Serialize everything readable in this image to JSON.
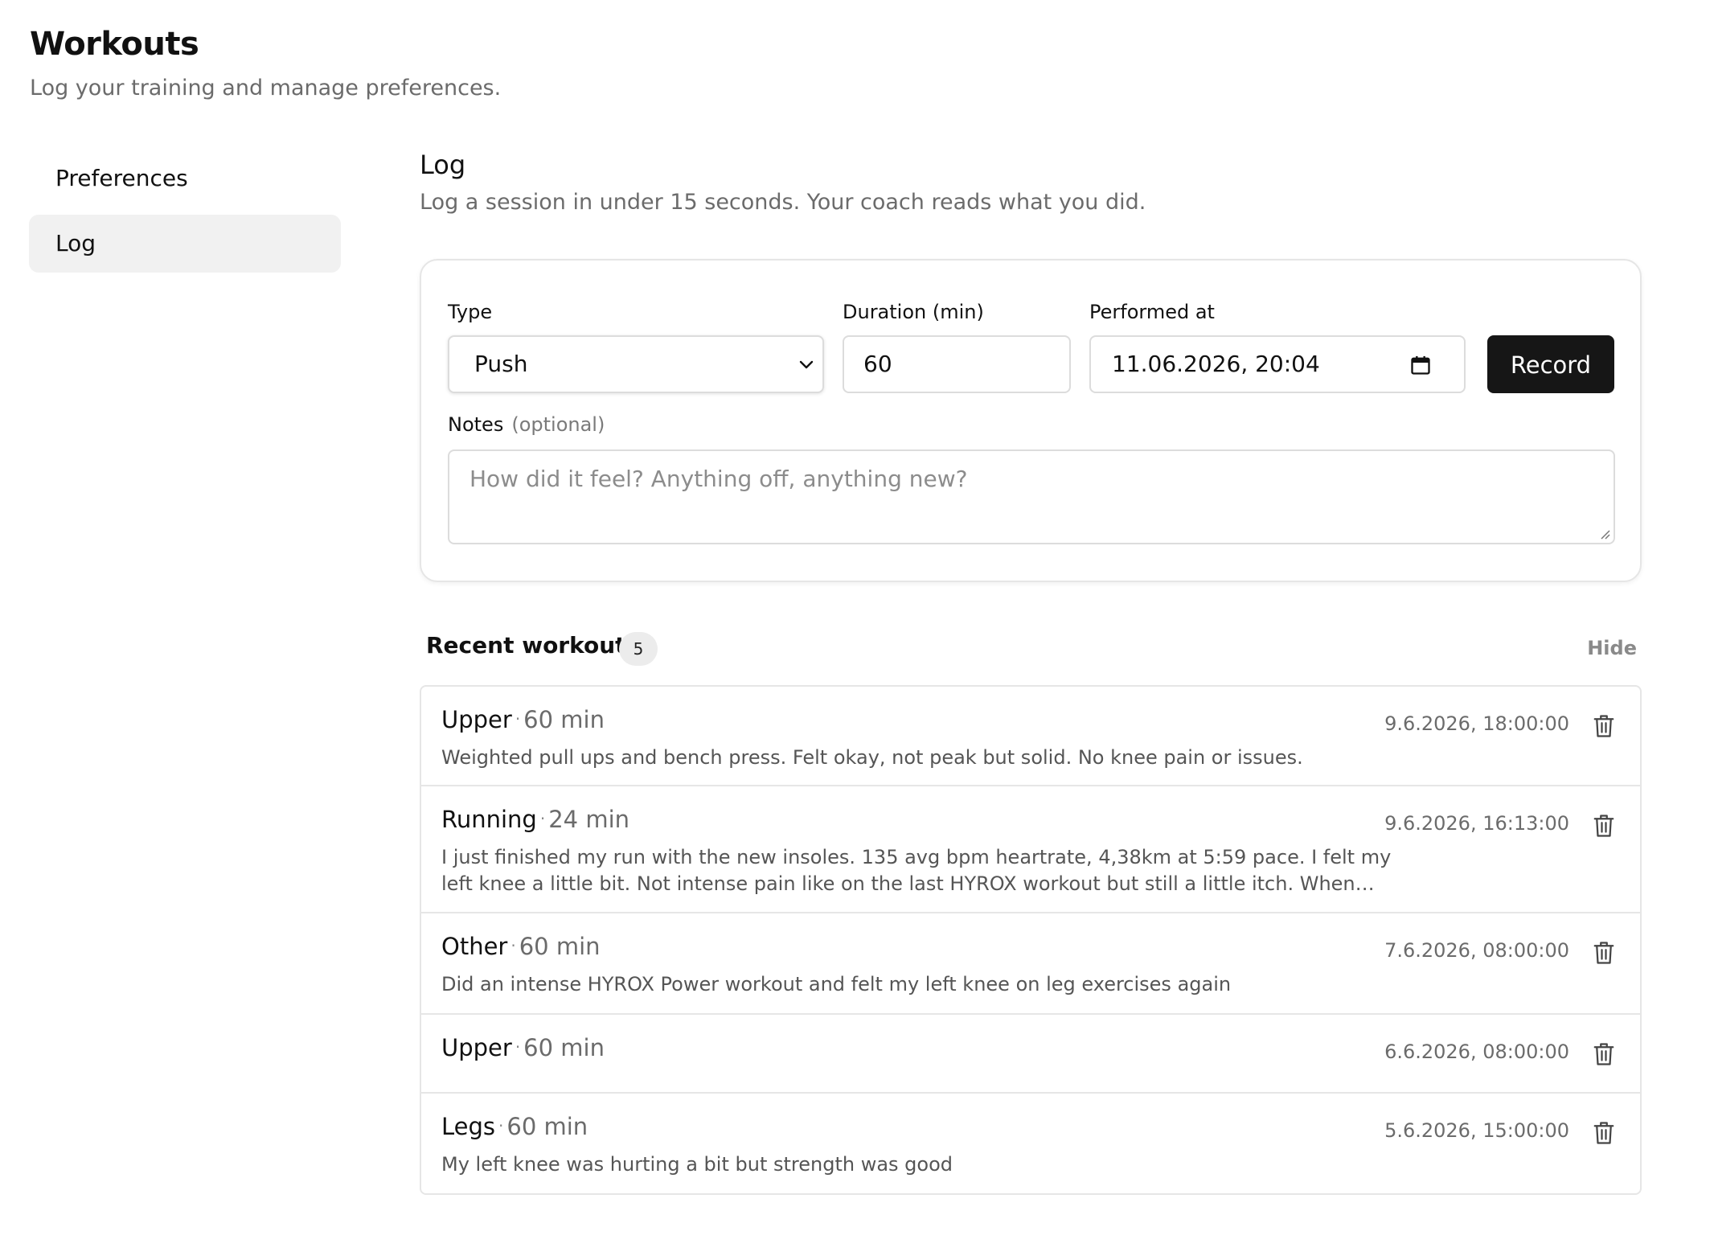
{
  "header": {
    "title": "Workouts",
    "subtitle": "Log your training and manage preferences."
  },
  "sidebar": {
    "items": [
      {
        "label": "Preferences",
        "active": false
      },
      {
        "label": "Log",
        "active": true
      }
    ]
  },
  "log": {
    "title": "Log",
    "subtitle": "Log a session in under 15 seconds. Your coach reads what you did.",
    "form": {
      "type_label": "Type",
      "type_value": "Push",
      "duration_label": "Duration (min)",
      "duration_value": "60",
      "performed_label": "Performed at",
      "performed_value": "11.06.2026, 20:04",
      "record_label": "Record",
      "notes_label": "Notes",
      "notes_optional": "(optional)",
      "notes_placeholder": "How did it feel? Anything off, anything new?"
    }
  },
  "recent": {
    "title": "Recent workouts",
    "count": "5",
    "hide_label": "Hide",
    "separator": "·",
    "items": [
      {
        "type": "Upper",
        "duration": "60 min",
        "date": "9.6.2026, 18:00:00",
        "note": "Weighted pull ups and bench press. Felt okay, not peak but solid. No knee pain or issues."
      },
      {
        "type": "Running",
        "duration": "24 min",
        "date": "9.6.2026, 16:13:00",
        "note": "I just finished my run with the new insoles. 135 avg bpm heartrate, 4,38km at 5:59 pace. I felt my left knee a little bit. Not intense pain like on the last HYROX workout but still a little itch. When slowing down even..."
      },
      {
        "type": "Other",
        "duration": "60 min",
        "date": "7.6.2026, 08:00:00",
        "note": "Did an intense HYROX Power workout and felt my left knee on leg exercises again"
      },
      {
        "type": "Upper",
        "duration": "60 min",
        "date": "6.6.2026, 08:00:00",
        "note": ""
      },
      {
        "type": "Legs",
        "duration": "60 min",
        "date": "5.6.2026, 15:00:00",
        "note": "My left knee was hurting a bit but strength was good"
      }
    ]
  }
}
